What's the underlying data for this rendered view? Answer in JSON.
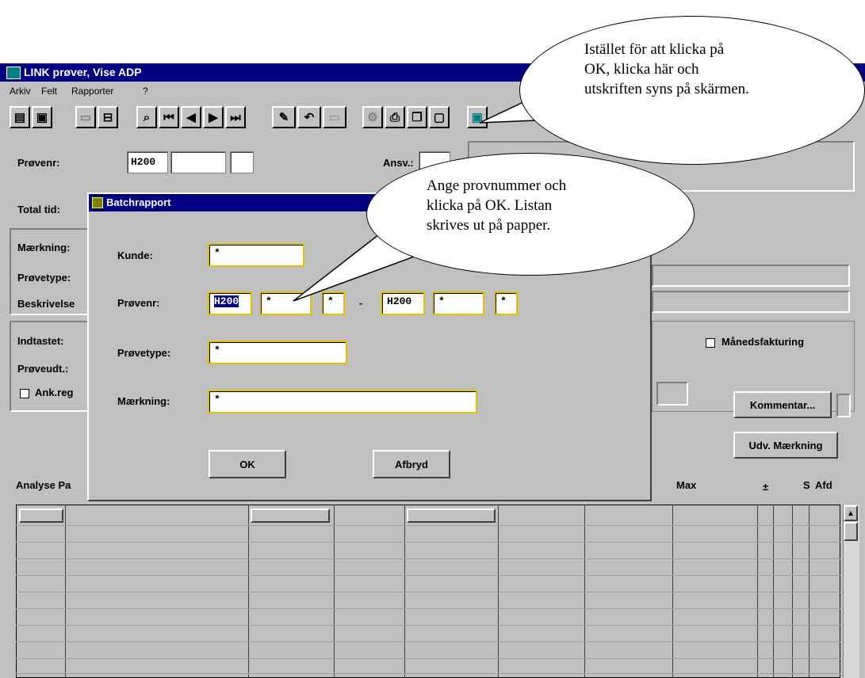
{
  "window": {
    "title": "LINK prøver, Vise ADP"
  },
  "menu": [
    "Arkiv",
    "Felt",
    "Rapporter",
    "?"
  ],
  "form": {
    "provenr_label": "Prøvenr:",
    "provenr_value": "H200",
    "ansv_label": "Ansv.:",
    "total_tid_label": "Total tid:",
    "maerkning_label": "Mærkning:",
    "provetype_label": "Prøvetype:",
    "beskrivelse_label": "Beskrivelse",
    "indtastet_label": "Indtastet:",
    "proveudt_label": "Prøveudt.:",
    "ank_reg_label": "Ank.reg",
    "manedsfakturing_label": "Månedsfakturing",
    "kommentar_button": "Kommentar...",
    "udv_maerkning_button": "Udv. Mærkning"
  },
  "table": {
    "header_left": "Analyse Pa",
    "header_max": "Max",
    "header_pm": "±",
    "header_s": "S",
    "header_afd": "Afd"
  },
  "dialog": {
    "title": "Batchrapport",
    "kunde_label": "Kunde:",
    "kunde_value": "*",
    "provenr_label": "Prøvenr:",
    "provenr_from": "H200",
    "provenr_from_2": "*",
    "provenr_from_3": "*",
    "dash": "-",
    "provenr_to": "H200",
    "provenr_to_2": "*",
    "provenr_to_3": "*",
    "provetype_label": "Prøvetype:",
    "provetype_value": "*",
    "maerkning_label": "Mærkning:",
    "maerkning_value": "*",
    "ok_button": "OK",
    "afbryd_button": "Afbryd"
  },
  "callouts": {
    "top": "Istället för att klicka på\nOK, klicka här och\nutskriften syns på skärmen.",
    "middle": "Ange  provnummer och\nklicka på OK. Listan\nskrives ut på papper."
  },
  "toolbar_icons": [
    "new-icon",
    "open-icon",
    "save-icon",
    "print-setup-icon",
    "search-icon",
    "first-record-icon",
    "prev-record-icon",
    "next-record-icon",
    "last-record-icon",
    "edit-icon",
    "undo-icon",
    "blank-icon",
    "tools-icon",
    "print-icon",
    "copy-icon",
    "paste-icon",
    "screen-preview-icon"
  ],
  "colors": {
    "titlebar": "#000080",
    "face": "#c0c0c0",
    "field_highlight": "#e0c000"
  }
}
